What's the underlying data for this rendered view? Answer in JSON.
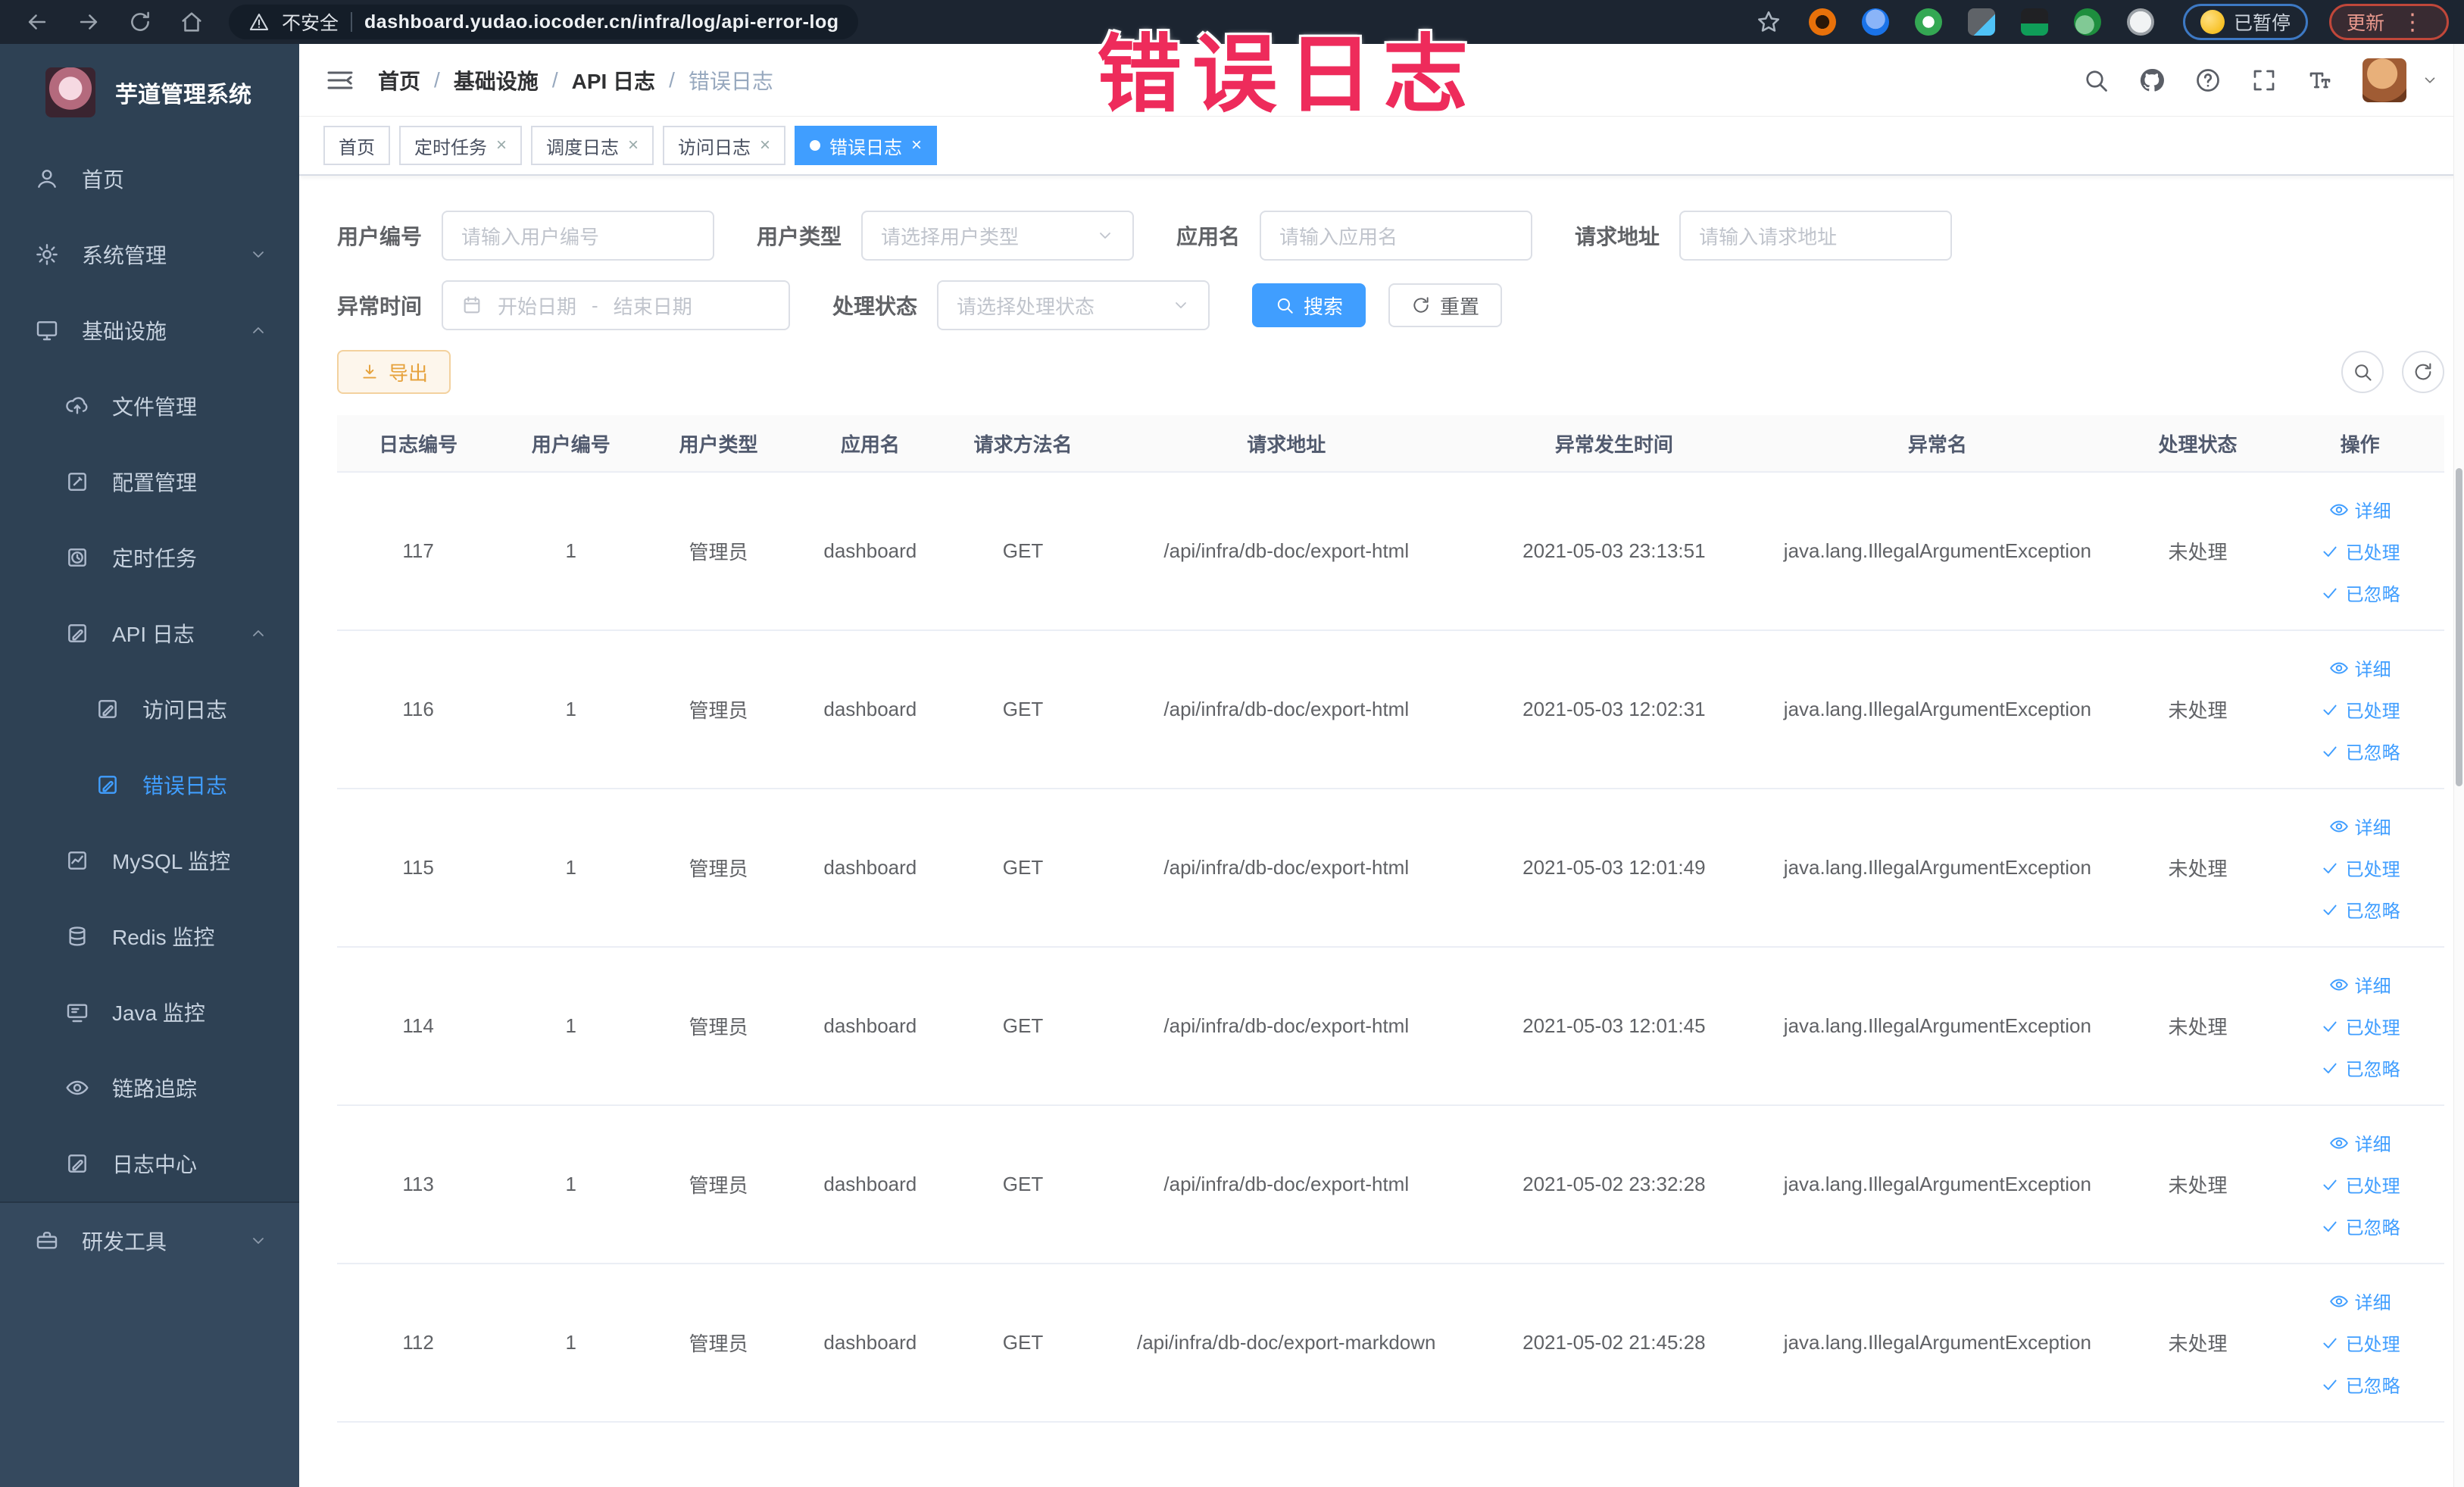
{
  "annotation": {
    "text": "错误日志"
  },
  "browser": {
    "security_label": "不安全",
    "url": "dashboard.yudao.iocoder.cn/infra/log/api-error-log",
    "paused_badge": "已暂停",
    "update_badge": "更新"
  },
  "sidebar": {
    "title": "芋道管理系统",
    "items": [
      {
        "label": "首页",
        "icon": "dashboard",
        "level": 0
      },
      {
        "label": "系统管理",
        "icon": "gear",
        "level": 0,
        "chevron": "down"
      },
      {
        "label": "基础设施",
        "icon": "monitor",
        "level": 0,
        "chevron": "up"
      },
      {
        "label": "文件管理",
        "icon": "cloud-upload",
        "level": 1
      },
      {
        "label": "配置管理",
        "icon": "edit",
        "level": 1
      },
      {
        "label": "定时任务",
        "icon": "clock",
        "level": 1
      },
      {
        "label": "API 日志",
        "icon": "doc-edit",
        "level": 1,
        "chevron": "up"
      },
      {
        "label": "访问日志",
        "icon": "doc-edit",
        "level": 2
      },
      {
        "label": "错误日志",
        "icon": "doc-edit",
        "level": 2,
        "active": true
      },
      {
        "label": "MySQL 监控",
        "icon": "chart",
        "level": 1
      },
      {
        "label": "Redis 监控",
        "icon": "stack",
        "level": 1
      },
      {
        "label": "Java 监控",
        "icon": "screen",
        "level": 1
      },
      {
        "label": "链路追踪",
        "icon": "eye",
        "level": 1
      },
      {
        "label": "日志中心",
        "icon": "doc-edit",
        "level": 1
      },
      {
        "label": "研发工具",
        "icon": "toolbox",
        "level": 0,
        "chevron": "down",
        "section": "bottom"
      }
    ]
  },
  "breadcrumb": [
    "首页",
    "基础设施",
    "API 日志",
    "错误日志"
  ],
  "tabs": [
    {
      "label": "首页",
      "closable": false,
      "active": false
    },
    {
      "label": "定时任务",
      "closable": true,
      "active": false
    },
    {
      "label": "调度日志",
      "closable": true,
      "active": false
    },
    {
      "label": "访问日志",
      "closable": true,
      "active": false
    },
    {
      "label": "错误日志",
      "closable": true,
      "active": true
    }
  ],
  "filters": {
    "user_id": {
      "label": "用户编号",
      "placeholder": "请输入用户编号"
    },
    "user_type": {
      "label": "用户类型",
      "placeholder": "请选择用户类型"
    },
    "app_name": {
      "label": "应用名",
      "placeholder": "请输入应用名"
    },
    "request_url": {
      "label": "请求地址",
      "placeholder": "请输入请求地址"
    },
    "exception_time": {
      "label": "异常时间",
      "start_placeholder": "开始日期",
      "separator": "-",
      "end_placeholder": "结束日期"
    },
    "process_status": {
      "label": "处理状态",
      "placeholder": "请选择处理状态"
    },
    "search_label": "搜索",
    "reset_label": "重置"
  },
  "toolbar": {
    "export_label": "导出"
  },
  "table": {
    "columns": [
      "日志编号",
      "用户编号",
      "用户类型",
      "应用名",
      "请求方法名",
      "请求地址",
      "异常发生时间",
      "异常名",
      "处理状态",
      "操作"
    ],
    "actions": [
      {
        "icon": "eye",
        "label": "详细"
      },
      {
        "icon": "check",
        "label": "已处理"
      },
      {
        "icon": "check",
        "label": "已忽略"
      }
    ],
    "rows": [
      {
        "log_id": "117",
        "user_id": "1",
        "user_type": "管理员",
        "app_name": "dashboard",
        "method": "GET",
        "url": "/api/infra/db-doc/export-html",
        "time": "2021-05-03 23:13:51",
        "exception": "java.lang.IllegalArgumentException",
        "status": "未处理"
      },
      {
        "log_id": "116",
        "user_id": "1",
        "user_type": "管理员",
        "app_name": "dashboard",
        "method": "GET",
        "url": "/api/infra/db-doc/export-html",
        "time": "2021-05-03 12:02:31",
        "exception": "java.lang.IllegalArgumentException",
        "status": "未处理"
      },
      {
        "log_id": "115",
        "user_id": "1",
        "user_type": "管理员",
        "app_name": "dashboard",
        "method": "GET",
        "url": "/api/infra/db-doc/export-html",
        "time": "2021-05-03 12:01:49",
        "exception": "java.lang.IllegalArgumentException",
        "status": "未处理"
      },
      {
        "log_id": "114",
        "user_id": "1",
        "user_type": "管理员",
        "app_name": "dashboard",
        "method": "GET",
        "url": "/api/infra/db-doc/export-html",
        "time": "2021-05-03 12:01:45",
        "exception": "java.lang.IllegalArgumentException",
        "status": "未处理"
      },
      {
        "log_id": "113",
        "user_id": "1",
        "user_type": "管理员",
        "app_name": "dashboard",
        "method": "GET",
        "url": "/api/infra/db-doc/export-html",
        "time": "2021-05-02 23:32:28",
        "exception": "java.lang.IllegalArgumentException",
        "status": "未处理"
      },
      {
        "log_id": "112",
        "user_id": "1",
        "user_type": "管理员",
        "app_name": "dashboard",
        "method": "GET",
        "url": "/api/infra/db-doc/export-markdown",
        "time": "2021-05-02 21:45:28",
        "exception": "java.lang.IllegalArgumentException",
        "status": "未处理"
      }
    ]
  },
  "colors": {
    "accent": "#409eff",
    "warning": "#e6a23c",
    "annotation": "#ee2b5b"
  }
}
